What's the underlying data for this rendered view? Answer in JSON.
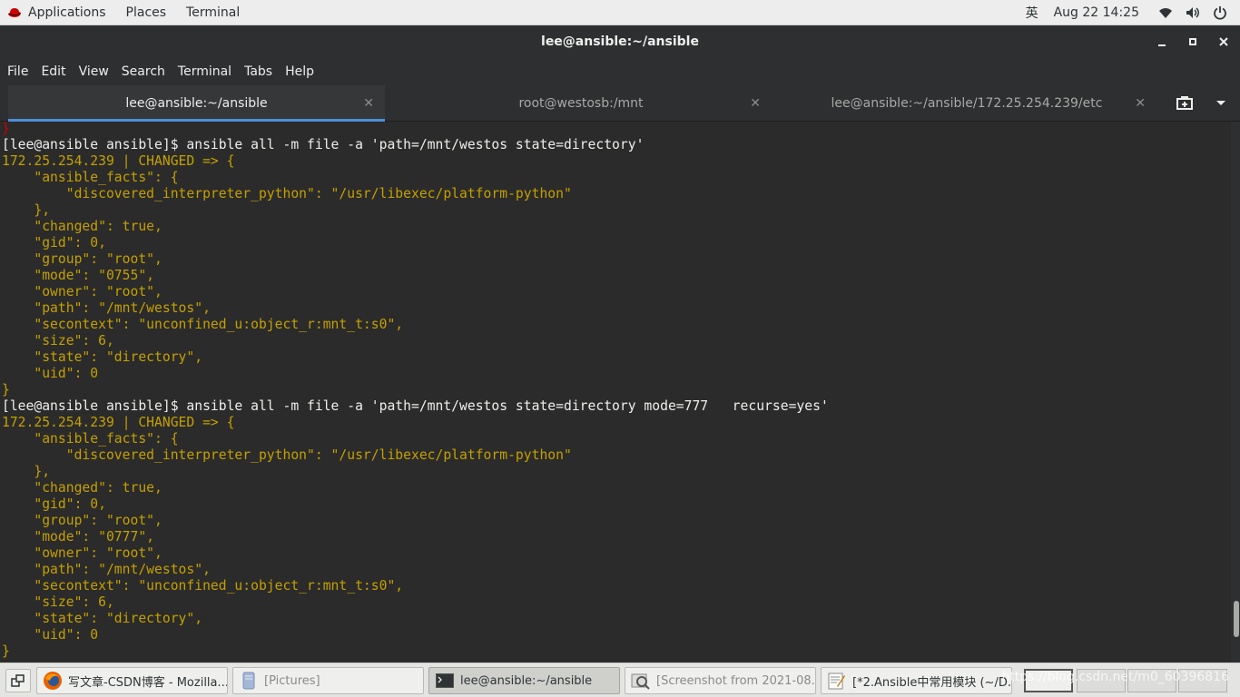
{
  "topbar": {
    "applications": "Applications",
    "places": "Places",
    "terminal": "Terminal",
    "input_method": "英",
    "clock": "Aug 22  14:25",
    "icons": [
      "redhat-icon",
      "wifi-icon",
      "volume-icon",
      "power-icon"
    ]
  },
  "window": {
    "title": "lee@ansible:~/ansible",
    "minimize": "_",
    "maximize": "▪",
    "close": "✕"
  },
  "menu": {
    "file": "File",
    "edit": "Edit",
    "view": "View",
    "search": "Search",
    "terminal": "Terminal",
    "tabs": "Tabs",
    "help": "Help"
  },
  "tabs": [
    {
      "label": "lee@ansible:~/ansible",
      "close": "✕",
      "active": true
    },
    {
      "label": "root@westosb:/mnt",
      "close": "✕",
      "active": false
    },
    {
      "label": "lee@ansible:~/ansible/172.25.254.239/etc",
      "close": "✕",
      "active": false
    }
  ],
  "terminal_lines": [
    {
      "t": "}",
      "c": "red"
    },
    {
      "t": "[lee@ansible ansible]$ ansible all -m file -a 'path=/mnt/westos state=directory'",
      "c": "cmd"
    },
    {
      "t": "172.25.254.239 | CHANGED => {",
      "c": "out"
    },
    {
      "t": "    \"ansible_facts\": {",
      "c": "out"
    },
    {
      "t": "        \"discovered_interpreter_python\": \"/usr/libexec/platform-python\"",
      "c": "out"
    },
    {
      "t": "    },",
      "c": "out"
    },
    {
      "t": "    \"changed\": true,",
      "c": "out"
    },
    {
      "t": "    \"gid\": 0,",
      "c": "out"
    },
    {
      "t": "    \"group\": \"root\",",
      "c": "out"
    },
    {
      "t": "    \"mode\": \"0755\",",
      "c": "out"
    },
    {
      "t": "    \"owner\": \"root\",",
      "c": "out"
    },
    {
      "t": "    \"path\": \"/mnt/westos\",",
      "c": "out"
    },
    {
      "t": "    \"secontext\": \"unconfined_u:object_r:mnt_t:s0\",",
      "c": "out"
    },
    {
      "t": "    \"size\": 6,",
      "c": "out"
    },
    {
      "t": "    \"state\": \"directory\",",
      "c": "out"
    },
    {
      "t": "    \"uid\": 0",
      "c": "out"
    },
    {
      "t": "}",
      "c": "out"
    },
    {
      "t": "[lee@ansible ansible]$ ansible all -m file -a 'path=/mnt/westos state=directory mode=777   recurse=yes'",
      "c": "cmd"
    },
    {
      "t": "172.25.254.239 | CHANGED => {",
      "c": "out"
    },
    {
      "t": "    \"ansible_facts\": {",
      "c": "out"
    },
    {
      "t": "        \"discovered_interpreter_python\": \"/usr/libexec/platform-python\"",
      "c": "out"
    },
    {
      "t": "    },",
      "c": "out"
    },
    {
      "t": "    \"changed\": true,",
      "c": "out"
    },
    {
      "t": "    \"gid\": 0,",
      "c": "out"
    },
    {
      "t": "    \"group\": \"root\",",
      "c": "out"
    },
    {
      "t": "    \"mode\": \"0777\",",
      "c": "out"
    },
    {
      "t": "    \"owner\": \"root\",",
      "c": "out"
    },
    {
      "t": "    \"path\": \"/mnt/westos\",",
      "c": "out"
    },
    {
      "t": "    \"secontext\": \"unconfined_u:object_r:mnt_t:s0\",",
      "c": "out"
    },
    {
      "t": "    \"size\": 6,",
      "c": "out"
    },
    {
      "t": "    \"state\": \"directory\",",
      "c": "out"
    },
    {
      "t": "    \"uid\": 0",
      "c": "out"
    },
    {
      "t": "}",
      "c": "out"
    }
  ],
  "colors": {
    "cmd": "#eeeeec",
    "out": "#c4a000",
    "red": "#cc0000",
    "accent": "#4a90d9"
  },
  "taskbar": [
    {
      "label": "写文章-CSDN博客 - Mozilla...",
      "icon": "firefox-icon",
      "active": false,
      "dim": false
    },
    {
      "label": "[Pictures]",
      "icon": "folder-icon",
      "active": false,
      "dim": true
    },
    {
      "label": "lee@ansible:~/ansible",
      "icon": "terminal-icon",
      "active": true,
      "dim": false
    },
    {
      "label": "[Screenshot from 2021-08...",
      "icon": "screenshot-icon",
      "active": false,
      "dim": true
    },
    {
      "label": "[*2.Ansible中常用模块 (~/D...",
      "icon": "text-editor-icon",
      "active": false,
      "dim": false
    }
  ],
  "watermark": "https://blog.csdn.net/m0_60396816"
}
